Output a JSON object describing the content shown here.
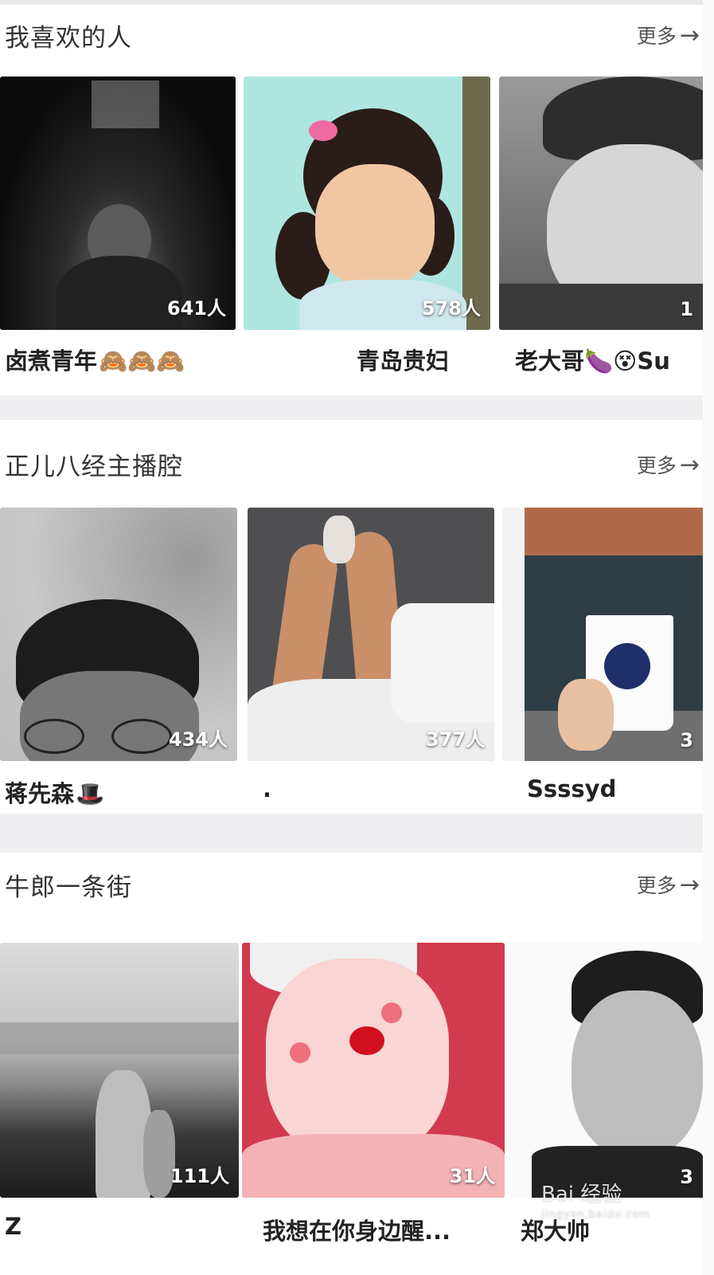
{
  "sections": [
    {
      "title": "我喜欢的人",
      "more": "更多",
      "cards": [
        {
          "count": "641人",
          "name": "卤煮青年",
          "emojis": "🙈🙈🙈"
        },
        {
          "count": "578人",
          "name": "青岛贵妇",
          "emojis": ""
        },
        {
          "count": "1",
          "name": "老大哥🍆😵Su",
          "emojis": ""
        }
      ]
    },
    {
      "title": "正儿八经主播腔",
      "more": "更多",
      "cards": [
        {
          "count": "434人",
          "name": "蒋先森",
          "emojis": "🎩"
        },
        {
          "count": "377人",
          "name": ".",
          "emojis": ""
        },
        {
          "count": "3",
          "name": "Ssssyd",
          "emojis": ""
        }
      ]
    },
    {
      "title": "牛郎一条街",
      "more": "更多",
      "cards": [
        {
          "count": "111人",
          "name": "Z",
          "emojis": ""
        },
        {
          "count": "31人",
          "name": "我想在你身边醒...",
          "emojis": ""
        },
        {
          "count": "3",
          "name": "郑大帅",
          "emojis": ""
        }
      ]
    }
  ],
  "watermark": {
    "text": "Bai 经验",
    "url": "jingyan.baidu.com"
  },
  "colors": {
    "background": "#efeff1",
    "card": "#ffffff",
    "text": "#222222",
    "muted": "#555555"
  }
}
